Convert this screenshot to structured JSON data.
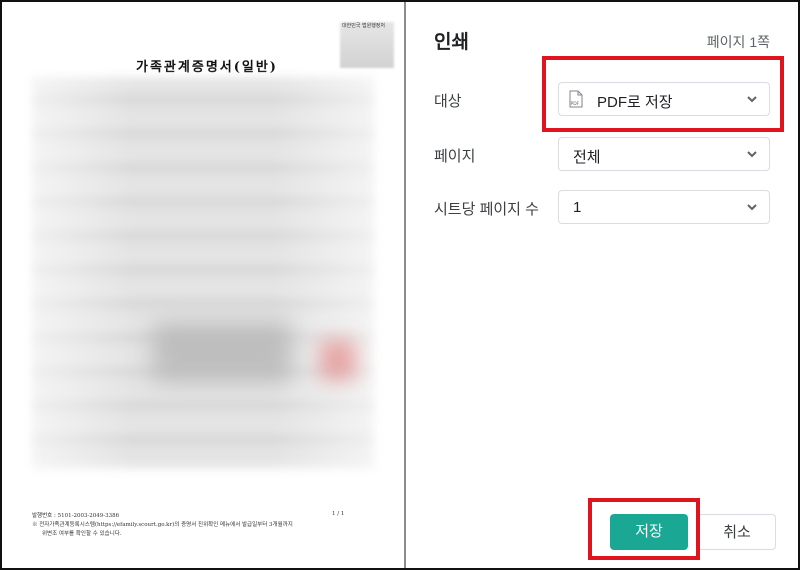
{
  "preview": {
    "seal_text": "대한민국 법원행정처",
    "doc_title": "가족관계증명서(일반)",
    "footer_issue_no": "발행번호 : 5101-2003-2049-3386",
    "footer_notice_1": "※ 전자가족관계등록시스템(https://efamily.scourt.go.kr)의 증명서 진위확인 메뉴에서 발급일부터 3개월까지",
    "footer_notice_2": "위변조 여부를 확인할 수 있습니다.",
    "page_indicator": "1 / 1"
  },
  "print_dialog": {
    "title": "인쇄",
    "page_count": "페이지 1쪽",
    "destination": {
      "label": "대상",
      "value": "PDF로 저장",
      "icon": "pdf-file-icon"
    },
    "pages": {
      "label": "페이지",
      "value": "전체"
    },
    "pages_per_sheet": {
      "label": "시트당 페이지 수",
      "value": "1"
    },
    "save_button": "저장",
    "cancel_button": "취소"
  },
  "colors": {
    "accent": "#1aa793",
    "highlight": "#e0141e",
    "text_primary": "#202124",
    "text_secondary": "#5f6368",
    "border": "#dadce0"
  }
}
